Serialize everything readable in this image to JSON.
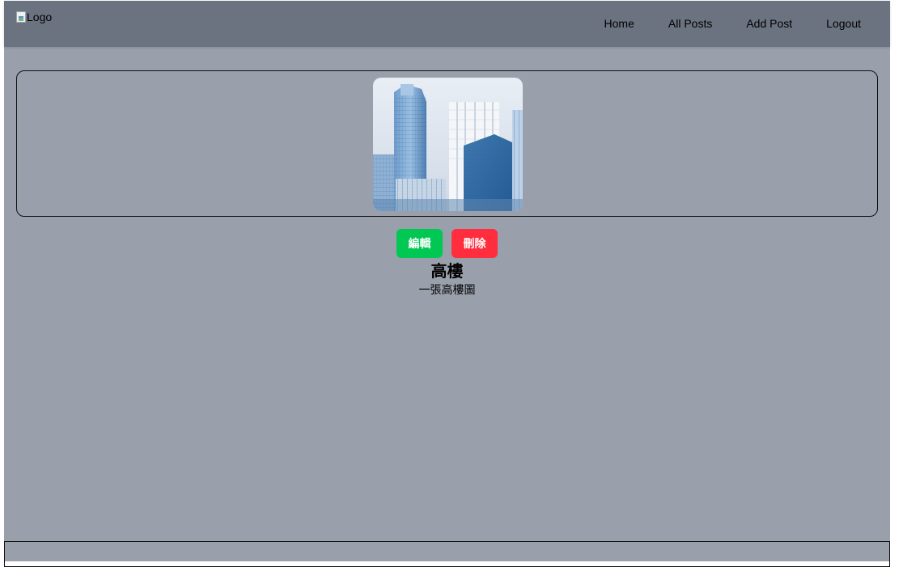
{
  "navbar": {
    "logo_alt": "Logo",
    "links": [
      {
        "label": "Home"
      },
      {
        "label": "All Posts"
      },
      {
        "label": "Add Post"
      },
      {
        "label": "Logout"
      }
    ]
  },
  "post": {
    "title": "高樓",
    "description": "一張高樓圖",
    "image_subject": "high-rise buildings",
    "edit_label": "編輯",
    "delete_label": "刪除"
  },
  "colors": {
    "navbar": "#6b7280",
    "page_background": "#9aa0ab",
    "edit_button": "#00c853",
    "delete_button": "#ff2d3d"
  }
}
